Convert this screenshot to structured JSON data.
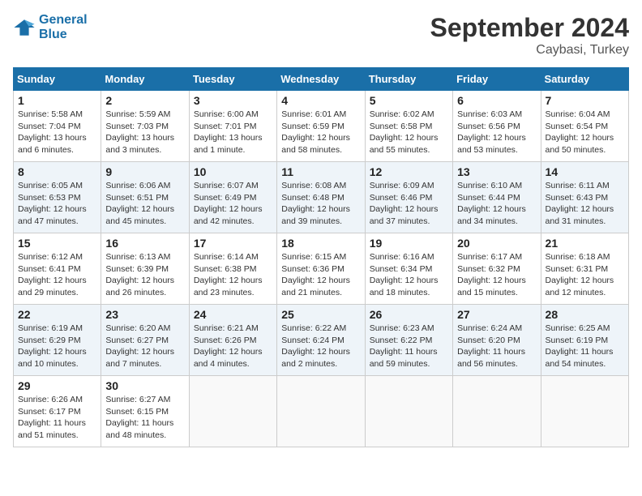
{
  "header": {
    "logo_line1": "General",
    "logo_line2": "Blue",
    "month": "September 2024",
    "location": "Caybasi, Turkey"
  },
  "weekdays": [
    "Sunday",
    "Monday",
    "Tuesday",
    "Wednesday",
    "Thursday",
    "Friday",
    "Saturday"
  ],
  "weeks": [
    [
      {
        "day": "1",
        "info": "Sunrise: 5:58 AM\nSunset: 7:04 PM\nDaylight: 13 hours\nand 6 minutes."
      },
      {
        "day": "2",
        "info": "Sunrise: 5:59 AM\nSunset: 7:03 PM\nDaylight: 13 hours\nand 3 minutes."
      },
      {
        "day": "3",
        "info": "Sunrise: 6:00 AM\nSunset: 7:01 PM\nDaylight: 13 hours\nand 1 minute."
      },
      {
        "day": "4",
        "info": "Sunrise: 6:01 AM\nSunset: 6:59 PM\nDaylight: 12 hours\nand 58 minutes."
      },
      {
        "day": "5",
        "info": "Sunrise: 6:02 AM\nSunset: 6:58 PM\nDaylight: 12 hours\nand 55 minutes."
      },
      {
        "day": "6",
        "info": "Sunrise: 6:03 AM\nSunset: 6:56 PM\nDaylight: 12 hours\nand 53 minutes."
      },
      {
        "day": "7",
        "info": "Sunrise: 6:04 AM\nSunset: 6:54 PM\nDaylight: 12 hours\nand 50 minutes."
      }
    ],
    [
      {
        "day": "8",
        "info": "Sunrise: 6:05 AM\nSunset: 6:53 PM\nDaylight: 12 hours\nand 47 minutes."
      },
      {
        "day": "9",
        "info": "Sunrise: 6:06 AM\nSunset: 6:51 PM\nDaylight: 12 hours\nand 45 minutes."
      },
      {
        "day": "10",
        "info": "Sunrise: 6:07 AM\nSunset: 6:49 PM\nDaylight: 12 hours\nand 42 minutes."
      },
      {
        "day": "11",
        "info": "Sunrise: 6:08 AM\nSunset: 6:48 PM\nDaylight: 12 hours\nand 39 minutes."
      },
      {
        "day": "12",
        "info": "Sunrise: 6:09 AM\nSunset: 6:46 PM\nDaylight: 12 hours\nand 37 minutes."
      },
      {
        "day": "13",
        "info": "Sunrise: 6:10 AM\nSunset: 6:44 PM\nDaylight: 12 hours\nand 34 minutes."
      },
      {
        "day": "14",
        "info": "Sunrise: 6:11 AM\nSunset: 6:43 PM\nDaylight: 12 hours\nand 31 minutes."
      }
    ],
    [
      {
        "day": "15",
        "info": "Sunrise: 6:12 AM\nSunset: 6:41 PM\nDaylight: 12 hours\nand 29 minutes."
      },
      {
        "day": "16",
        "info": "Sunrise: 6:13 AM\nSunset: 6:39 PM\nDaylight: 12 hours\nand 26 minutes."
      },
      {
        "day": "17",
        "info": "Sunrise: 6:14 AM\nSunset: 6:38 PM\nDaylight: 12 hours\nand 23 minutes."
      },
      {
        "day": "18",
        "info": "Sunrise: 6:15 AM\nSunset: 6:36 PM\nDaylight: 12 hours\nand 21 minutes."
      },
      {
        "day": "19",
        "info": "Sunrise: 6:16 AM\nSunset: 6:34 PM\nDaylight: 12 hours\nand 18 minutes."
      },
      {
        "day": "20",
        "info": "Sunrise: 6:17 AM\nSunset: 6:32 PM\nDaylight: 12 hours\nand 15 minutes."
      },
      {
        "day": "21",
        "info": "Sunrise: 6:18 AM\nSunset: 6:31 PM\nDaylight: 12 hours\nand 12 minutes."
      }
    ],
    [
      {
        "day": "22",
        "info": "Sunrise: 6:19 AM\nSunset: 6:29 PM\nDaylight: 12 hours\nand 10 minutes."
      },
      {
        "day": "23",
        "info": "Sunrise: 6:20 AM\nSunset: 6:27 PM\nDaylight: 12 hours\nand 7 minutes."
      },
      {
        "day": "24",
        "info": "Sunrise: 6:21 AM\nSunset: 6:26 PM\nDaylight: 12 hours\nand 4 minutes."
      },
      {
        "day": "25",
        "info": "Sunrise: 6:22 AM\nSunset: 6:24 PM\nDaylight: 12 hours\nand 2 minutes."
      },
      {
        "day": "26",
        "info": "Sunrise: 6:23 AM\nSunset: 6:22 PM\nDaylight: 11 hours\nand 59 minutes."
      },
      {
        "day": "27",
        "info": "Sunrise: 6:24 AM\nSunset: 6:20 PM\nDaylight: 11 hours\nand 56 minutes."
      },
      {
        "day": "28",
        "info": "Sunrise: 6:25 AM\nSunset: 6:19 PM\nDaylight: 11 hours\nand 54 minutes."
      }
    ],
    [
      {
        "day": "29",
        "info": "Sunrise: 6:26 AM\nSunset: 6:17 PM\nDaylight: 11 hours\nand 51 minutes."
      },
      {
        "day": "30",
        "info": "Sunrise: 6:27 AM\nSunset: 6:15 PM\nDaylight: 11 hours\nand 48 minutes."
      },
      {
        "day": "",
        "info": ""
      },
      {
        "day": "",
        "info": ""
      },
      {
        "day": "",
        "info": ""
      },
      {
        "day": "",
        "info": ""
      },
      {
        "day": "",
        "info": ""
      }
    ]
  ]
}
